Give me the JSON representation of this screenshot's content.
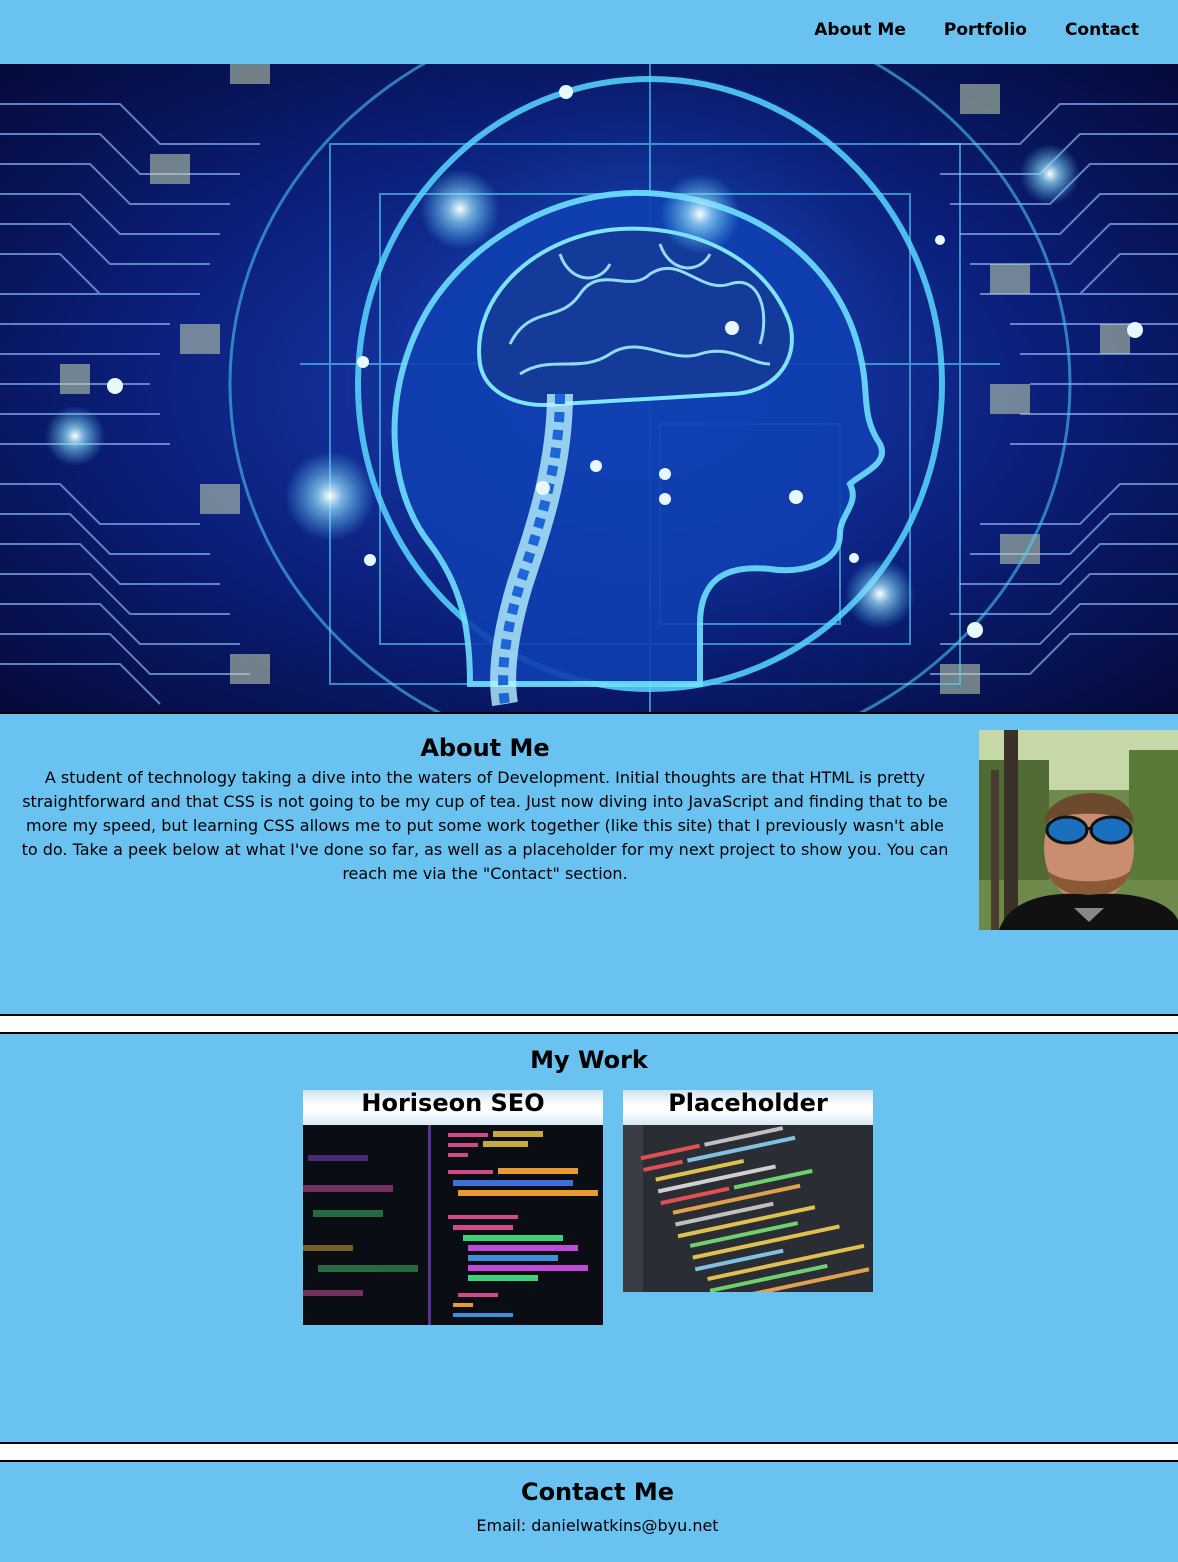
{
  "nav": {
    "items": [
      "About Me",
      "Portfolio",
      "Contact"
    ]
  },
  "about": {
    "title": "About Me",
    "text": "A student of technology taking a dive into the waters of Development. Initial thoughts are that HTML is pretty straightforward and that CSS is not going to be my cup of tea. Just now diving into JavaScript and finding that to be more my speed, but learning CSS allows me to put some work together (like this site) that I previously wasn't able to do. Take a peek below at what I've done so far, as well as a placeholder for my next project to show you. You can reach me via the \"Contact\" section."
  },
  "work": {
    "title": "My Work",
    "projects": [
      {
        "title": "Horiseon SEO"
      },
      {
        "title": "Placeholder"
      }
    ]
  },
  "contact": {
    "title": "Contact Me",
    "email": "Email: danielwatkins@byu.net"
  },
  "colors": {
    "section_bg": "#69c2f0",
    "hero_bg": "#0a1048",
    "accent_glow": "#4fd1ff"
  }
}
